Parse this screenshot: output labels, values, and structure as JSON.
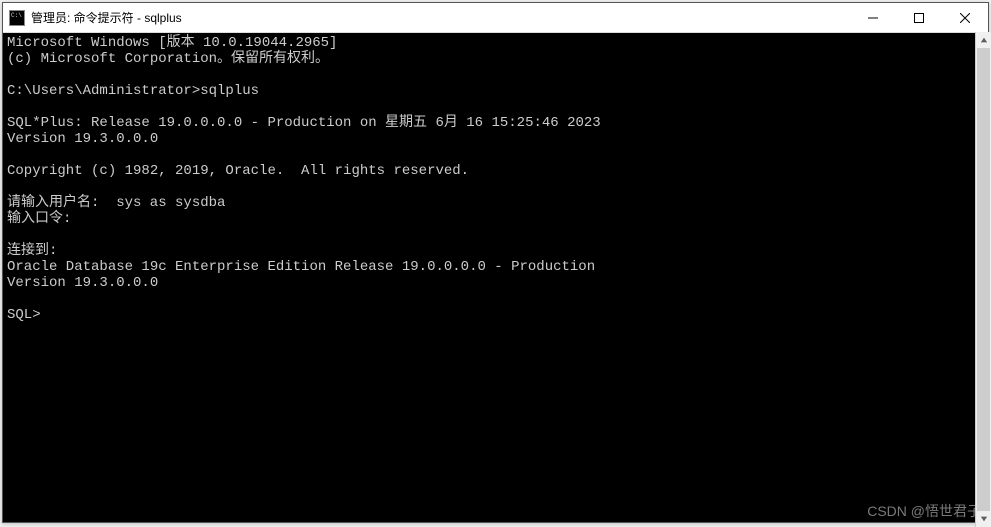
{
  "window": {
    "title": "管理员: 命令提示符 - sqlplus"
  },
  "terminal": {
    "lines": [
      "Microsoft Windows [版本 10.0.19044.2965]",
      "(c) Microsoft Corporation。保留所有权利。",
      "",
      "C:\\Users\\Administrator>sqlplus",
      "",
      "SQL*Plus: Release 19.0.0.0.0 - Production on 星期五 6月 16 15:25:46 2023",
      "Version 19.3.0.0.0",
      "",
      "Copyright (c) 1982, 2019, Oracle.  All rights reserved.",
      "",
      "请输入用户名:  sys as sysdba",
      "输入口令:",
      "",
      "连接到:",
      "Oracle Database 19c Enterprise Edition Release 19.0.0.0.0 - Production",
      "Version 19.3.0.0.0",
      "",
      "SQL>"
    ]
  },
  "watermark": "CSDN @悟世君子"
}
